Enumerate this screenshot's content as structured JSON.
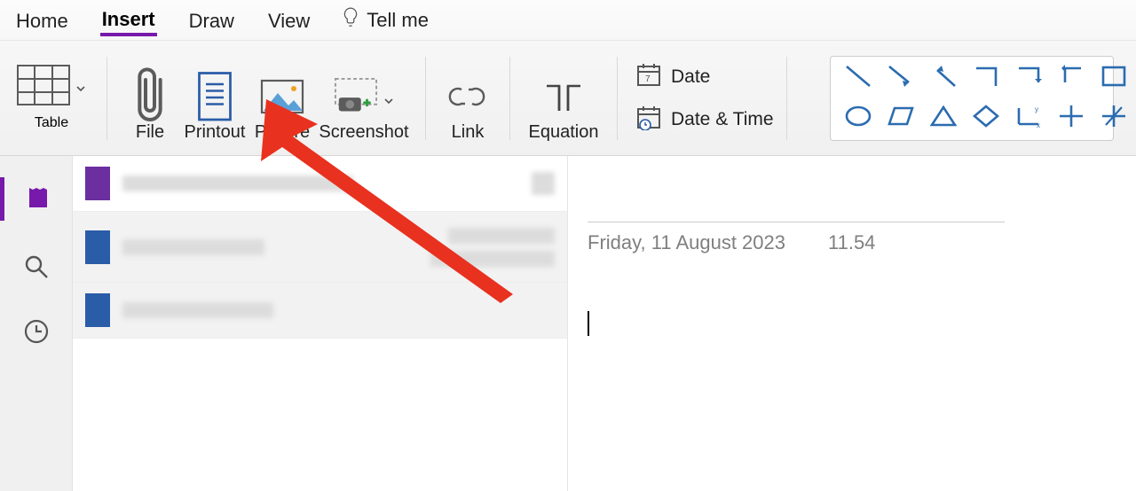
{
  "tabs": {
    "home": "Home",
    "insert": "Insert",
    "draw": "Draw",
    "view": "View",
    "tellme": "Tell me"
  },
  "ribbon": {
    "table": "Table",
    "file": "File",
    "printout": "Printout",
    "picture": "Picture",
    "screenshot": "Screenshot",
    "link": "Link",
    "equation": "Equation",
    "date": "Date",
    "date_time": "Date & Time"
  },
  "note": {
    "date": "Friday, 11 August 2023",
    "time": "11.54"
  },
  "colors": {
    "accent": "#7719aa",
    "shape": "#2b6cb0",
    "arrow": "#e8311f"
  }
}
